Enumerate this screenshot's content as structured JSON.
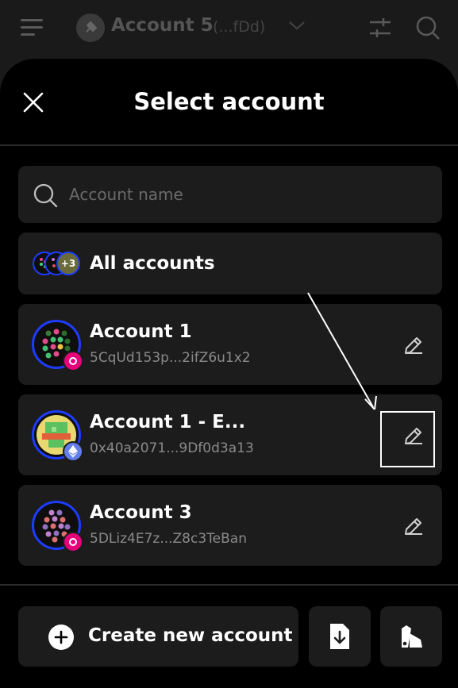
{
  "header": {
    "account_name": "Account 5",
    "account_addr": "(...fDd)",
    "icons": [
      "menu-icon",
      "plug-icon",
      "chevron-down-icon",
      "sliders-icon",
      "search-icon"
    ]
  },
  "sheet": {
    "title": "Select account",
    "close_icon": "close-icon"
  },
  "search": {
    "placeholder": "Account name",
    "value": ""
  },
  "all_accounts": {
    "label": "All accounts",
    "more_count": "+3"
  },
  "accounts": [
    {
      "name": "Account 1",
      "address": "5CqUd153p...2ifZ6u1x2",
      "chain": "polkadot"
    },
    {
      "name": "Account 1 - E...",
      "address": "0x40a2071...9Df0d3a13",
      "chain": "ethereum"
    },
    {
      "name": "Account 3",
      "address": "5DLiz4E7z...Z8c3TeBan",
      "chain": "polkadot"
    }
  ],
  "footer": {
    "create_label": "Create new account",
    "import_icon": "file-import-icon",
    "attach_icon": "swatch-icon"
  },
  "colors": {
    "avatar_ring": "#1d3cff",
    "polkadot_badge": "#e6007a",
    "ethereum_badge": "#627eea",
    "row_bg": "#1c1c1c"
  }
}
